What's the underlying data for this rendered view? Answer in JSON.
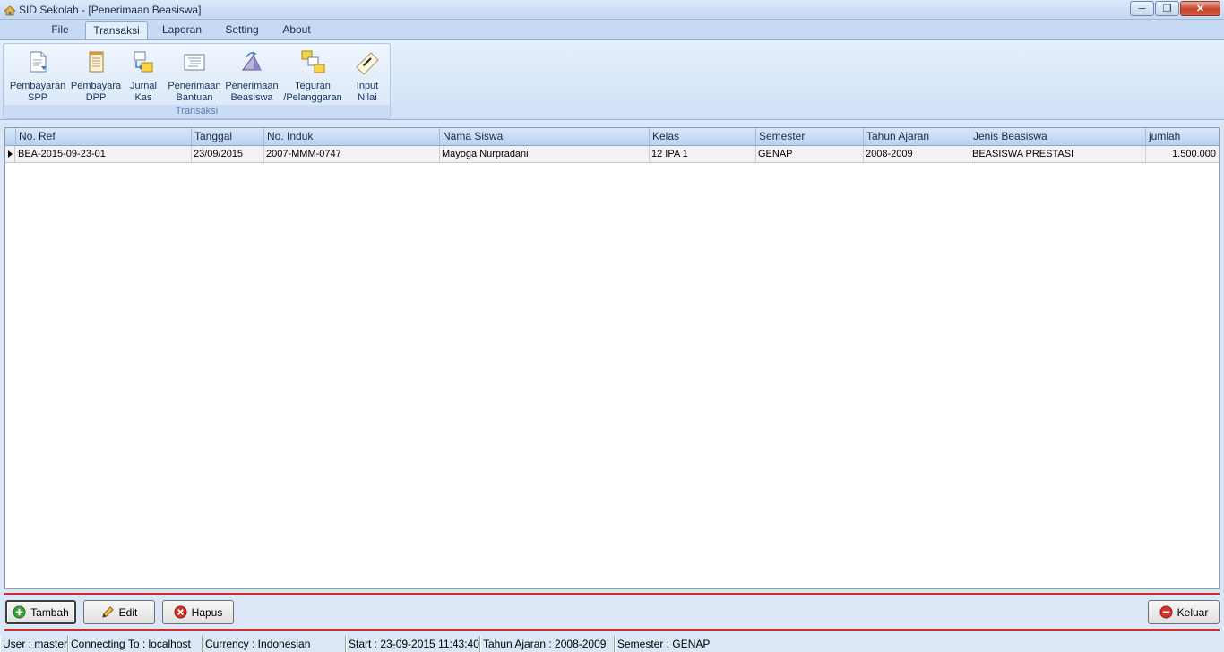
{
  "window": {
    "title": "SID Sekolah - [Penerimaan Beasiswa]"
  },
  "menu": {
    "tabs": [
      "File",
      "Transaksi",
      "Laporan",
      "Setting",
      "About"
    ],
    "active": "Transaksi"
  },
  "ribbon": {
    "group_label": "Transaksi",
    "buttons": [
      {
        "line1": "Pembayaran",
        "line2": "SPP",
        "icon": "document-money-icon"
      },
      {
        "line1": "Pembayara",
        "line2": "DPP",
        "icon": "notepad-icon"
      },
      {
        "line1": "Jurnal",
        "line2": "Kas",
        "icon": "journal-icon"
      },
      {
        "line1": "Penerimaan",
        "line2": "Bantuan",
        "icon": "list-icon"
      },
      {
        "line1": "Penerimaan",
        "line2": "Beasiswa",
        "icon": "triangle-icon"
      },
      {
        "line1": "Teguran",
        "line2": "/Pelanggaran",
        "icon": "stacked-boxes-icon"
      },
      {
        "line1": "Input",
        "line2": "Nilai",
        "icon": "pen-paper-icon"
      }
    ]
  },
  "grid": {
    "columns": [
      "No. Ref",
      "Tanggal",
      "No. Induk",
      "Nama Siswa",
      "Kelas",
      "Semester",
      "Tahun Ajaran",
      "Jenis Beasiswa",
      "jumlah"
    ],
    "rows": [
      [
        "BEA-2015-09-23-01",
        "23/09/2015",
        "2007-MMM-0747",
        "Mayoga Nurpradani",
        "12 IPA 1",
        "GENAP",
        "2008-2009",
        "BEASISWA PRESTASI",
        "1.500.000"
      ]
    ]
  },
  "buttons": {
    "tambah": "Tambah",
    "edit": "Edit",
    "hapus": "Hapus",
    "keluar": "Keluar"
  },
  "status": {
    "user": "User : master",
    "connecting": "Connecting To : localhost",
    "currency": "Currency : Indonesian",
    "start": "Start  : 23-09-2015 11:43:40",
    "tahun": "Tahun Ajaran : 2008-2009",
    "semester": "Semester : GENAP"
  }
}
